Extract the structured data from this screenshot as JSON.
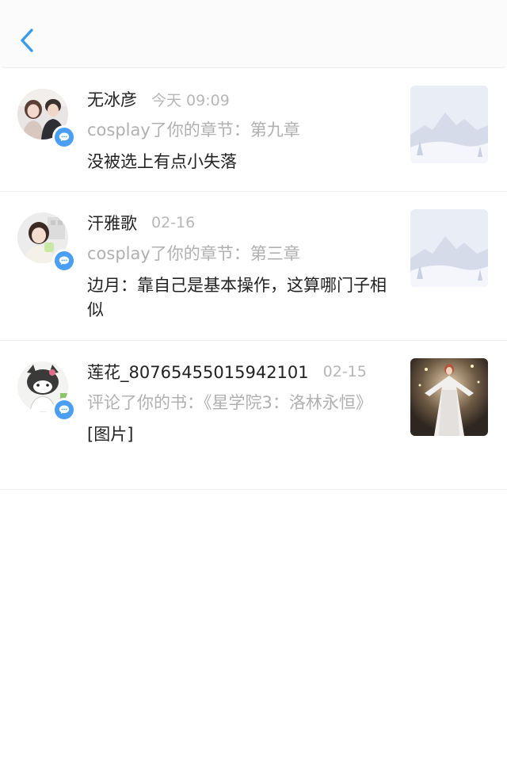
{
  "header": {
    "back_icon": "chevron-left-icon",
    "accent_color": "#3a9ce9"
  },
  "notifications": [
    {
      "user": "无冰彦",
      "time": "今天 09:09",
      "action": "cosplay了你的章节：第九章",
      "message": "没被选上有点小失落",
      "badge_icon": "message-icon",
      "thumbnail": "placeholder-mountain-image"
    },
    {
      "user": "汗雅歌",
      "time": "02-16",
      "action": "cosplay了你的章节：第三章",
      "message": "边月：靠自己是基本操作，这算哪门子相似",
      "badge_icon": "message-icon",
      "thumbnail": "placeholder-mountain-image"
    },
    {
      "user": "莲花_80765455015942101",
      "time": "02-15",
      "action": "评论了你的书：《星学院3：洛林永恒》",
      "message": "[图片]",
      "badge_icon": "message-icon",
      "thumbnail": "book-cover-image"
    }
  ]
}
